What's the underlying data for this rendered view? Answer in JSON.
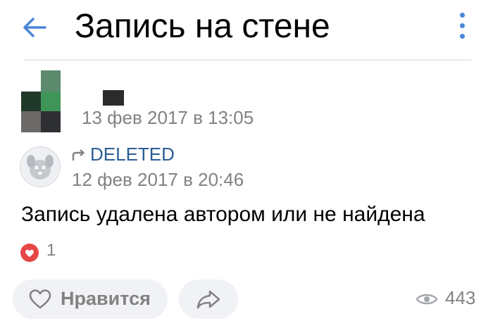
{
  "header": {
    "title": "Запись на стене",
    "back_icon": "arrow-left-icon",
    "menu_icon": "more-vertical-icon",
    "accent": "#4a86d8"
  },
  "post": {
    "date": "13 фев 2017 в 13:05",
    "repost": {
      "name": "DELETED",
      "date": "12 фев 2017 в 20:46",
      "icon": "repost-arrow-icon"
    },
    "text": "Запись удалена автором или не найдена",
    "likes_count": "1"
  },
  "actions": {
    "like_label": "Нравится",
    "share_icon": "share-arrow-icon",
    "views": "443",
    "views_icon": "eye-icon"
  },
  "colors": {
    "link": "#2c5d95",
    "meta": "#828282",
    "like_red": "#e64646",
    "button_bg": "#f0f2f5"
  }
}
